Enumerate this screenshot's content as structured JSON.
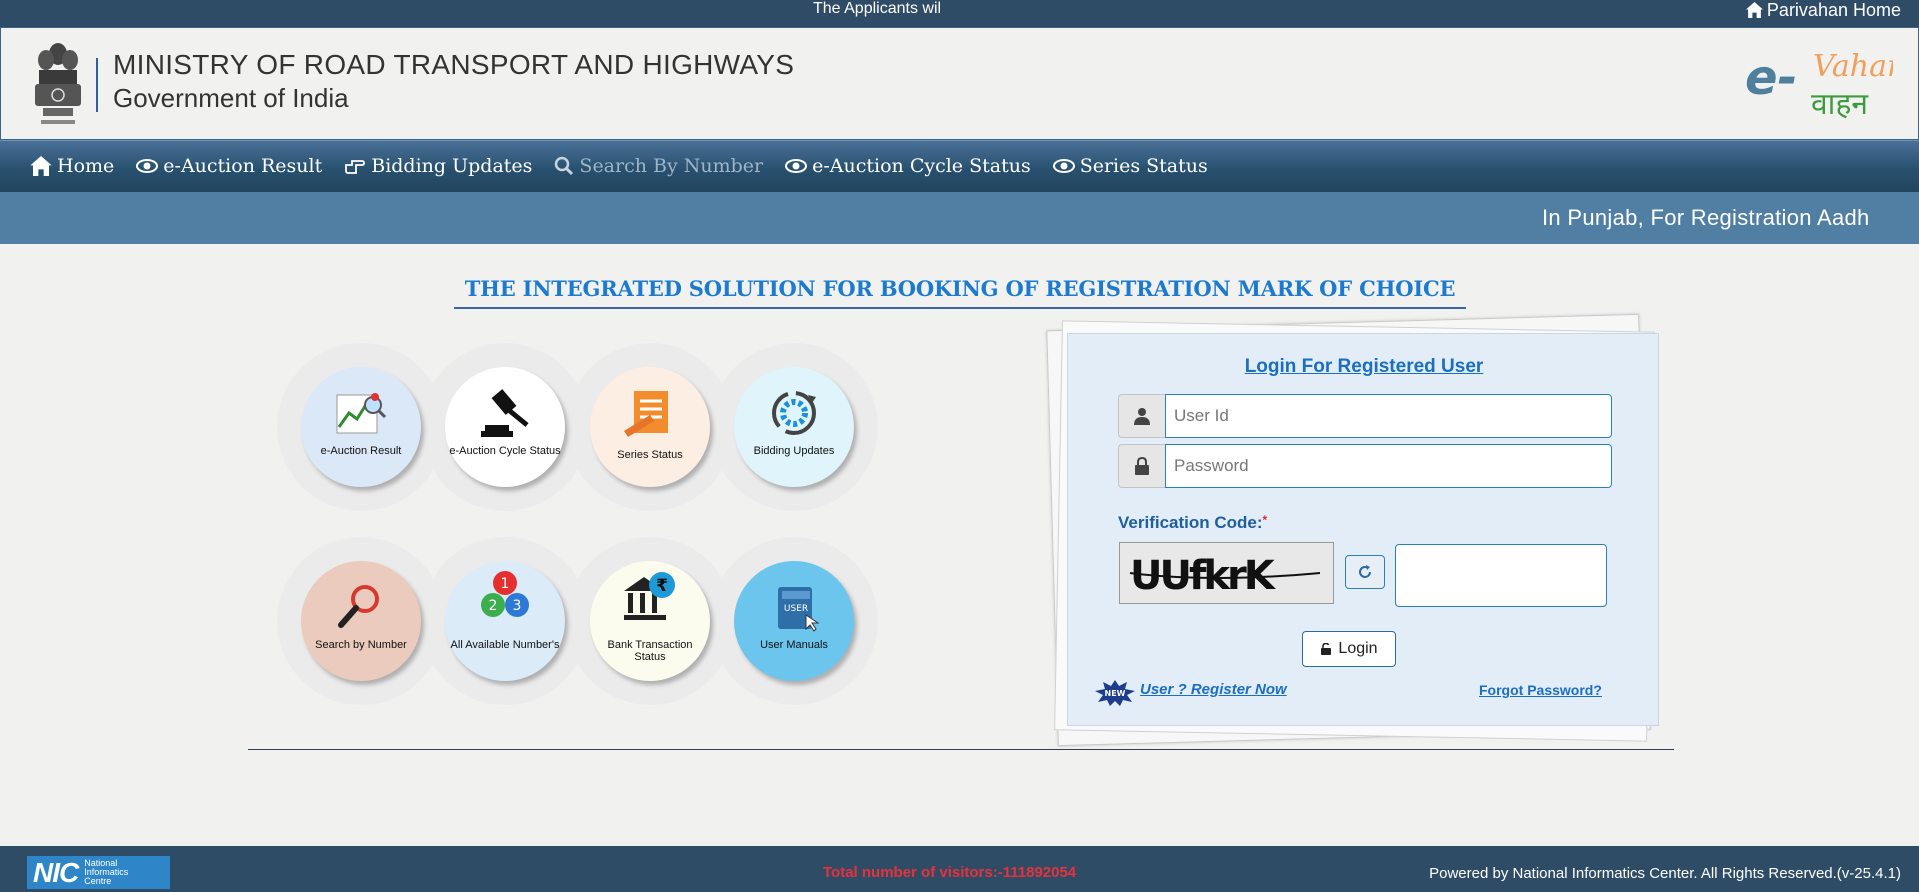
{
  "topbar": {
    "marquee": "The Applicants wil",
    "home_link": "Parivahan Home"
  },
  "header": {
    "ministry": "MINISTRY OF ROAD TRANSPORT AND HIGHWAYS",
    "government": "Government of India",
    "logo_prefix": "e-",
    "logo_english": "Vahan",
    "logo_hindi": "वाहन"
  },
  "nav": {
    "items": [
      {
        "label": "Home",
        "icon": "home-icon"
      },
      {
        "label": "e-Auction Result",
        "icon": "eye-icon"
      },
      {
        "label": "Bidding Updates",
        "icon": "hand-point-icon"
      },
      {
        "label": "Search By Number",
        "icon": "search-icon",
        "active": true
      },
      {
        "label": "e-Auction Cycle Status",
        "icon": "eye-icon"
      },
      {
        "label": "Series Status",
        "icon": "eye-icon"
      }
    ]
  },
  "news": {
    "text": "In Punjab, For Registration Aadh"
  },
  "main": {
    "title": "THE INTEGRATED SOLUTION FOR BOOKING OF REGISTRATION MARK OF CHOICE"
  },
  "tiles": [
    {
      "label": "e-Auction Result",
      "icon": "auction-result-icon",
      "bg": "#dbe8f7"
    },
    {
      "label": "e-Auction Cycle Status",
      "icon": "gavel-icon",
      "bg": "#ffffff"
    },
    {
      "label": "Series Status",
      "icon": "series-document-icon",
      "bg": "#fdeee3"
    },
    {
      "label": "Bidding Updates",
      "icon": "refresh-cycle-icon",
      "bg": "#dff4fb"
    },
    {
      "label": "Search by Number",
      "icon": "magnifier-icon",
      "bg": "#eacbbd"
    },
    {
      "label": "All Available Number's",
      "icon": "numbered-balls-icon",
      "bg": "#dcebf8"
    },
    {
      "label": "Bank Transaction Status",
      "icon": "bank-rupee-icon",
      "bg": "#fcfcee"
    },
    {
      "label": "User Manuals",
      "icon": "user-manual-book-icon",
      "bg": "#6bc5ec"
    }
  ],
  "login": {
    "title": "Login For Registered User",
    "userid_placeholder": "User Id",
    "password_placeholder": "Password",
    "verification_label": "Verification Code:",
    "required_mark": "*",
    "captcha_text": "UUfkrK",
    "login_button": "Login",
    "new_badge": "NEW",
    "register_link": "User ? Register Now",
    "forgot_link": "Forgot Password?"
  },
  "footer": {
    "nic_short": "NIC",
    "nic_full_1": "National",
    "nic_full_2": "Informatics",
    "nic_full_3": "Centre",
    "visitors": "Total number of visitors:-111892054",
    "powered": "Powered by National Informatics Center. All Rights Reserved.(v-25.4.1)"
  },
  "colors": {
    "topbar": "#2f4c66",
    "nav": "#28516f",
    "news_bar": "#517fa4",
    "title_blue": "#1c7bd0",
    "login_panel": "#e3edf8",
    "visitors_red": "#e8313a"
  }
}
